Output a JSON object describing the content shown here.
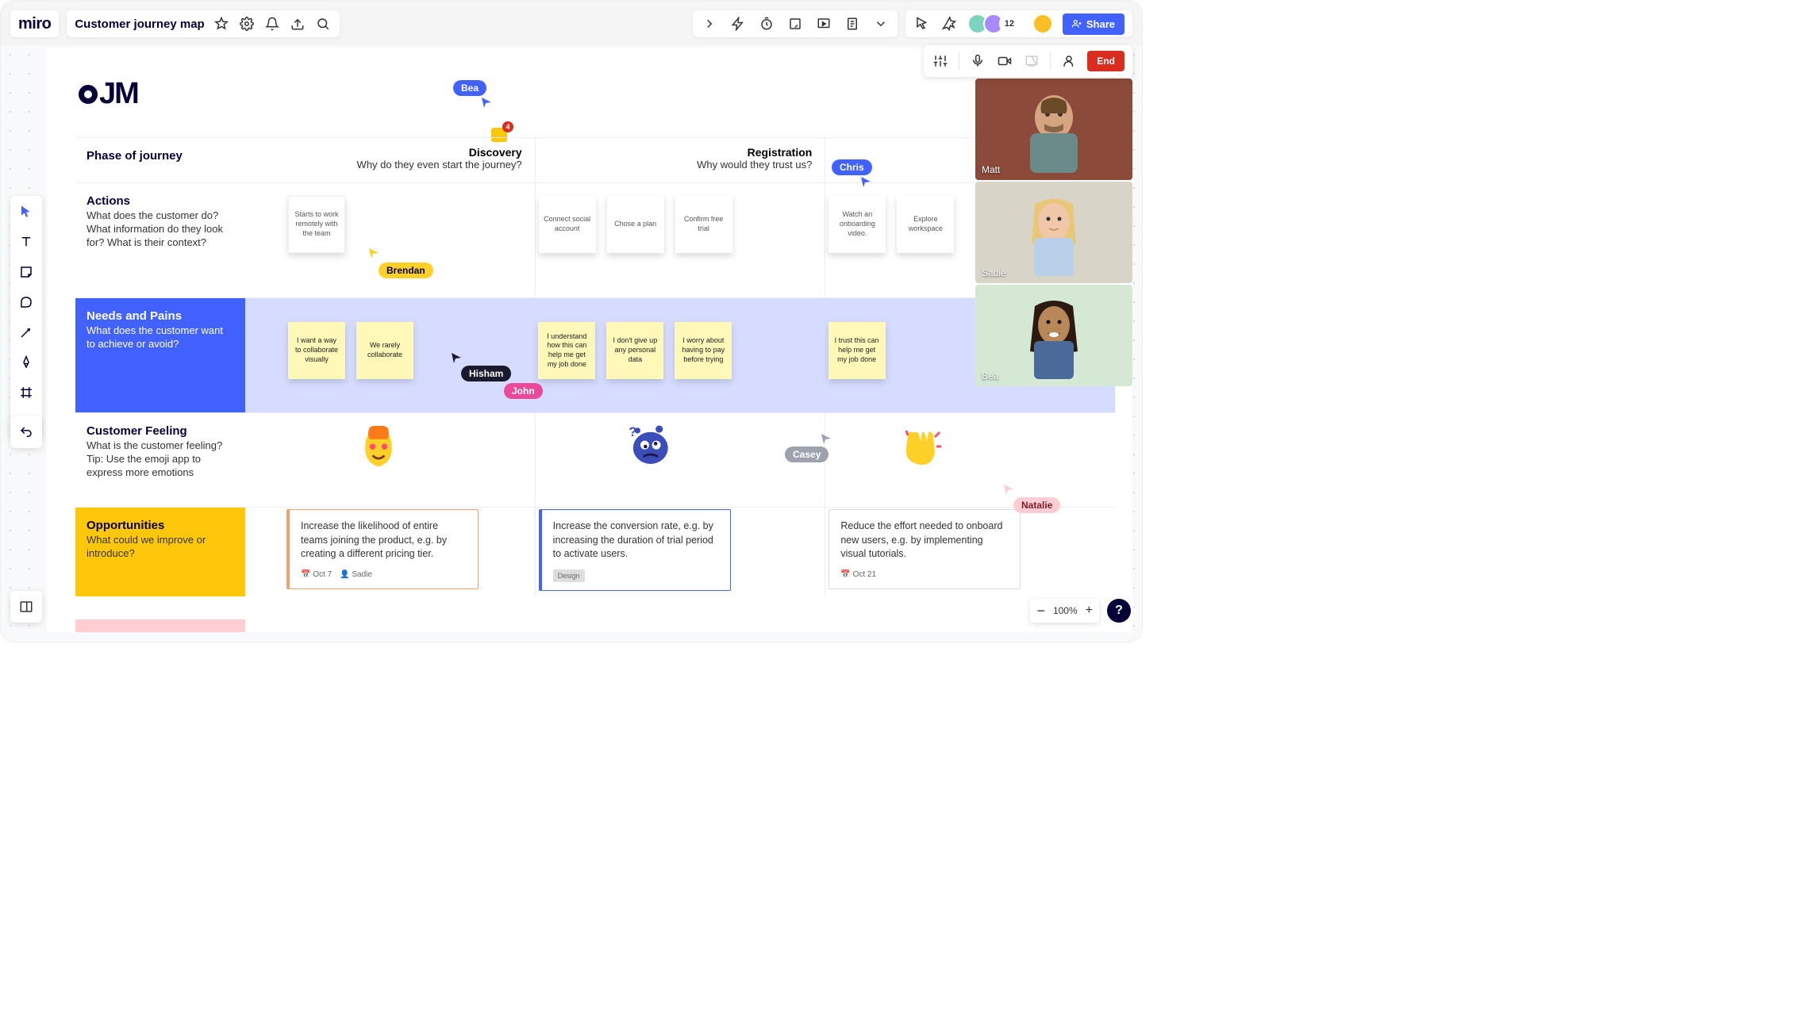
{
  "header": {
    "logo": "miro",
    "board_title": "Customer journey map",
    "share_label": "Share",
    "guest_count": "12"
  },
  "facilitation": {
    "end_label": "End"
  },
  "video": {
    "participants": [
      "Matt",
      "Sadie",
      "Bea"
    ]
  },
  "zoom": {
    "level": "100%"
  },
  "help": "?",
  "board": {
    "title": "CJM",
    "comment_count": "4",
    "rows": {
      "phase": {
        "label": "Phase of journey"
      },
      "actions": {
        "label": "Actions",
        "sub": "What does the customer do? What information do they look for? What is their context?"
      },
      "needs": {
        "label": "Needs and Pains",
        "sub": "What does the customer want to achieve or avoid?"
      },
      "feeling": {
        "label": "Customer Feeling",
        "sub": "What is the customer feeling? Tip: Use the emoji app to express more emotions"
      },
      "opps": {
        "label": "Opportunities",
        "sub": "What could we improve or introduce?"
      }
    },
    "phases": {
      "discovery": {
        "title": "Discovery",
        "sub": "Why do they even start the journey?"
      },
      "registration": {
        "title": "Registration",
        "sub": "Why would they trust us?"
      },
      "onboarding": {
        "title": "",
        "sub": ""
      }
    },
    "stickies": {
      "a1": "Starts to work remotely with the team",
      "a2": "Connect  social account",
      "a3": "Chose a plan",
      "a4": "Confirm free trial",
      "a5": "Watch an onboarding video.",
      "a6": "Explore workspace",
      "n1": "I want a way to collaborate visually",
      "n2": "We rarely collaborate",
      "n3": "I understand how this can help me get my job done",
      "n4": "I don't give up any personal data",
      "n5": "I worry about having to pay before trying",
      "n6": "I trust this can help me get my job done"
    },
    "cursors": {
      "bea": "Bea",
      "chris": "Chris",
      "brendan": "Brendan",
      "hisham": "Hisham",
      "john": "John",
      "casey": "Casey",
      "natalie": "Natalie"
    },
    "opportunities": {
      "o1": {
        "text": "Increase the likelihood of entire teams joining the product, e.g. by creating a different pricing tier.",
        "date": "Oct 7",
        "owner": "Sadie"
      },
      "o2": {
        "text": "Increase the conversion rate, e.g. by increasing the duration of trial period to activate users.",
        "tag": "Design"
      },
      "o3": {
        "text": "Reduce the effort needed to onboard new users, e.g. by implementing visual tutorials.",
        "date": "Oct 21"
      }
    }
  }
}
